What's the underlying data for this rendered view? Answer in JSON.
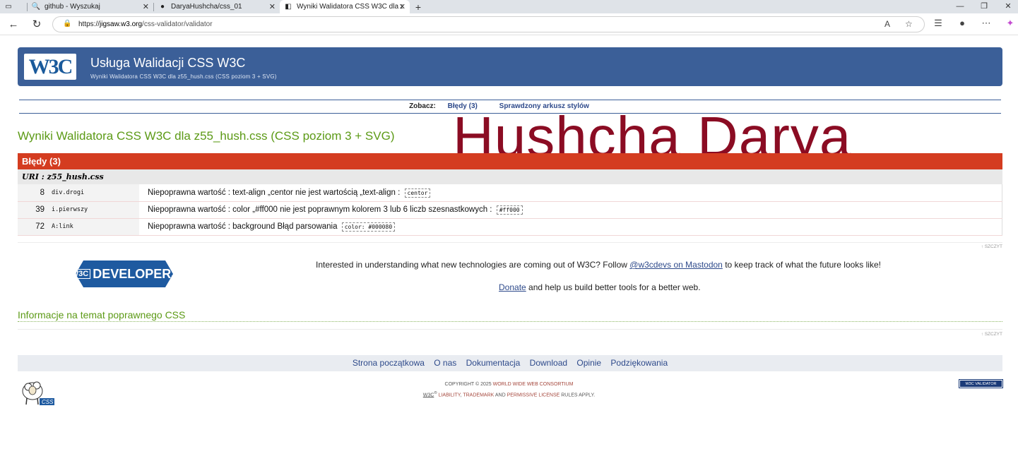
{
  "browser": {
    "tabs": [
      {
        "title": "github - Wyszukaj"
      },
      {
        "title": "DaryaHushcha/css_01"
      },
      {
        "title": "Wyniki Walidatora CSS W3C dla z"
      }
    ],
    "url_prefix": "https://",
    "url_host": "jigsaw.w3.org",
    "url_path": "/css-validator/validator"
  },
  "banner": {
    "logo_text": "W3C",
    "title": "Usługa Walidacji CSS W3C",
    "subtitle": "Wyniki Walidatora CSS W3C dla z55_hush.css (CSS poziom 3 + SVG)"
  },
  "see_bar": {
    "label": "Zobacz:",
    "links": [
      "Błędy (3)",
      "Sprawdzony arkusz stylów"
    ]
  },
  "watermark": "Hushcha Darya",
  "results_title": "Wyniki Walidatora CSS W3C dla z55_hush.css (CSS poziom 3 + SVG)",
  "errors": {
    "header": "Błędy (3)",
    "uri": "URI : z55_hush.css",
    "rows": [
      {
        "line": "8",
        "context": "div.drogi",
        "message": "Niepoprawna wartość : text-align „centor nie jest wartością „text-align :",
        "code": "centor"
      },
      {
        "line": "39",
        "context": "i.pierwszy",
        "message": "Niepoprawna wartość : color „#ff000 nie jest poprawnym kolorem 3 lub 6 liczb szesnastkowych :",
        "code": "#ff000"
      },
      {
        "line": "72",
        "context": "A:link",
        "message": "Niepoprawna wartość : background Błąd parsowania",
        "code": "color: #000080"
      }
    ]
  },
  "top_link": "↑ SZCZYT",
  "developers": {
    "logo_w3c": "W3C",
    "logo_text": "DEVELOPERS",
    "interest_before": "Interested in understanding what new technologies are coming out of W3C? Follow ",
    "interest_link": "@w3cdevs on Mastodon",
    "interest_after": " to keep track of what the future looks like!",
    "donate_link": "Donate",
    "donate_after": " and help us build better tools for a better web."
  },
  "info_title": "Informacje na temat poprawnego CSS",
  "footer_nav": [
    "Strona początkowa",
    "O nas",
    "Dokumentacja",
    "Download",
    "Opinie",
    "Podziękowania"
  ],
  "copyright": {
    "line1_prefix": "COPYRIGHT © 2025 ",
    "line1_link": "WORLD WIDE WEB CONSORTIUM",
    "line2_w3c": "W3C",
    "line2_reg": "®",
    "line2_a": " LIABILITY",
    "line2_b": ", ",
    "line2_c": "TRADEMARK",
    "line2_d": " AND ",
    "line2_e": "PERMISSIVE LICENSE",
    "line2_f": " RULES APPLY."
  },
  "badge": "W3C VALIDATOR",
  "colors": {
    "banner": "#3b5f98",
    "error_header": "#d43c20",
    "title_green": "#5c9a16",
    "watermark": "#8b0c23"
  }
}
